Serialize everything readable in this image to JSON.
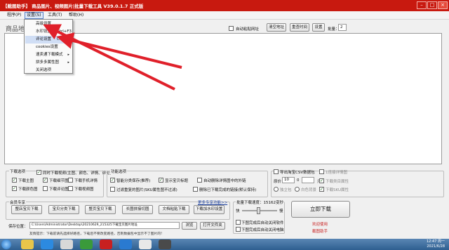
{
  "window": {
    "title": "【截图助手】  商品图片、视频图片|批量下载工具 V39.0.1.7 正式版",
    "minimize_glyph": "–",
    "maximize_glyph": "□",
    "close_glyph": "×"
  },
  "menubar": {
    "items": [
      "程序(P)",
      "设置(S)",
      "工具(T)",
      "帮助(H)"
    ]
  },
  "dropdown": {
    "items": [
      {
        "label": "高级设置",
        "shortcut": "",
        "arrow": ""
      },
      {
        "label": "水印设置",
        "shortcut": "Ctrl+F3",
        "arrow": ""
      },
      {
        "label": "评论设置",
        "shortcut": "Ctrl+F4",
        "arrow": ""
      },
      {
        "label": "cookies设置",
        "shortcut": "",
        "arrow": ""
      },
      {
        "label": "速卖通下载模式",
        "shortcut": "",
        "arrow": "▸"
      },
      {
        "label": "拼多多属性图",
        "shortcut": "",
        "arrow": "▸"
      },
      {
        "label": "关闭选项",
        "shortcut": "",
        "arrow": ""
      }
    ]
  },
  "url_area": {
    "label": "商品地",
    "auto_paste_label": "自动粘贴网址",
    "clear_button": "清空地址",
    "requery_button": "重查时间",
    "settings_button": "设置",
    "batch_label": "批量：",
    "batch_value": "2"
  },
  "download_options": {
    "title": "下载选项",
    "download_all": "同时下载视频(主图、颜色、详情、评论)",
    "items": [
      "下载主图",
      "下载细节图",
      "下载手机详情",
      "下载颜色图",
      "下载评论图",
      "下载视频图",
      "下载评论图"
    ]
  },
  "function_options": {
    "title": "功能选项",
    "items": [
      "智能分类保存(推荐)",
      "显示宝贝标题",
      "自动删除详情图中的外链",
      "过滤重复的图片(SKU属性图不过滤)",
      "删除已下载完成的链接(默认保持)"
    ]
  },
  "right_options": {
    "export_csv": "导出淘宝CSV数据包",
    "detail_image": "1连接详情图",
    "original_label": "原价",
    "original_value": "10",
    "zero_label": "0",
    "yuan": "元",
    "download_category": "下载类目属性",
    "separate_img": "独立包",
    "white_bg": "白色背景",
    "download_sku": "下载SKU属性"
  },
  "member_features": {
    "title": "会员专享",
    "more_link": "更多专享功能>>",
    "buttons": [
      "整店宝贝下载",
      "宝贝分类下载",
      "整页宝贝下载",
      "长图拼接切图",
      "文档粘贴下载",
      "下载加水印设置"
    ]
  },
  "speed": {
    "title": "批量下载速度：15162变秒",
    "fast": "快",
    "slow": "慢",
    "option_shutdown": "下图完成后自动关闭软件",
    "option_poweroff": "下图完成后自动关闭电脑"
  },
  "save": {
    "label": "保存位置：",
    "path": "C:\\Users\\Administrator\\Desktop\\20210629_215325下载宝贝图片地址",
    "browse_button": "浏览",
    "open_button": "打开文件夹",
    "tip": "友情提示：下载前请先选择好路径，下载后不要改变路径，否则数据包中显示不了图片的!"
  },
  "download_button": "立即下载",
  "welcome": "欢迎使用",
  "helper": "截图助手",
  "clock": {
    "time": "12:47 周一",
    "date": "2021/6/28"
  },
  "colors": {
    "title_bar": "#c8190f",
    "accent": "#c82020",
    "menu_highlight": "#d0def5",
    "arrow": "#e0202a"
  }
}
